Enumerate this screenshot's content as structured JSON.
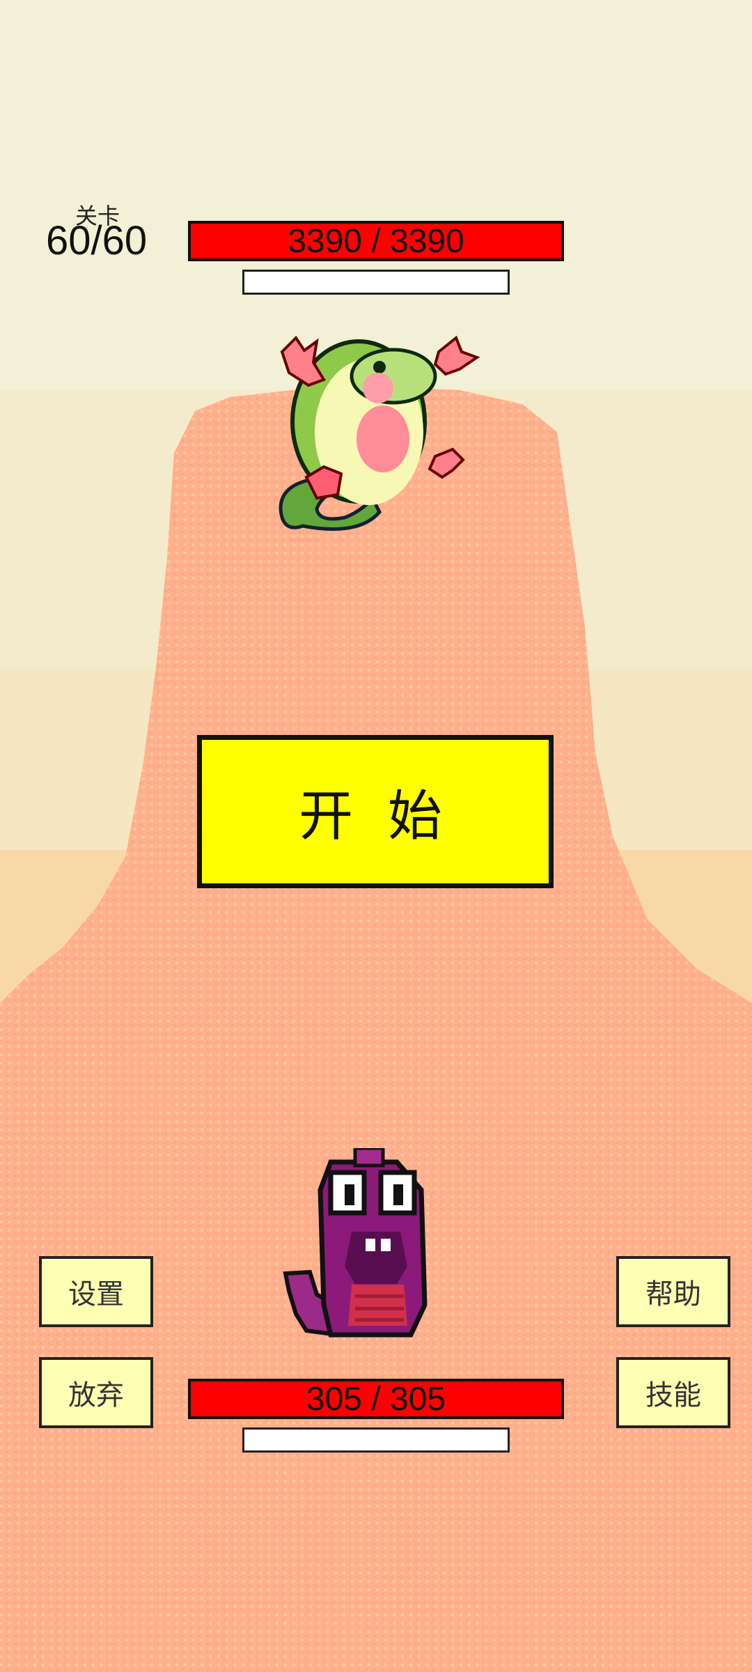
{
  "level": {
    "label": "关卡",
    "value": "60/60"
  },
  "enemy": {
    "hp_text": "3390 / 3390",
    "hp_fraction": 1.0,
    "secondary_fraction": 0.0
  },
  "player": {
    "hp_text": "305 / 305",
    "hp_fraction": 1.0,
    "secondary_fraction": 0.0
  },
  "start_button": {
    "label": "开 始"
  },
  "buttons": {
    "settings": "设置",
    "give_up": "放弃",
    "help": "帮助",
    "skills": "技能"
  },
  "colors": {
    "sky_top": "#f2f0d6",
    "sky_mid": "#f5e9c6",
    "sand": "#f8d8a8",
    "ground": "#ff987a",
    "mound": "#ffb08c",
    "hp_red": "#ff0000",
    "start_yellow": "#ffff00",
    "button_cream": "#ffffb3"
  },
  "sprites": {
    "enemy": "lizard-monster",
    "player": "purple-snake"
  }
}
